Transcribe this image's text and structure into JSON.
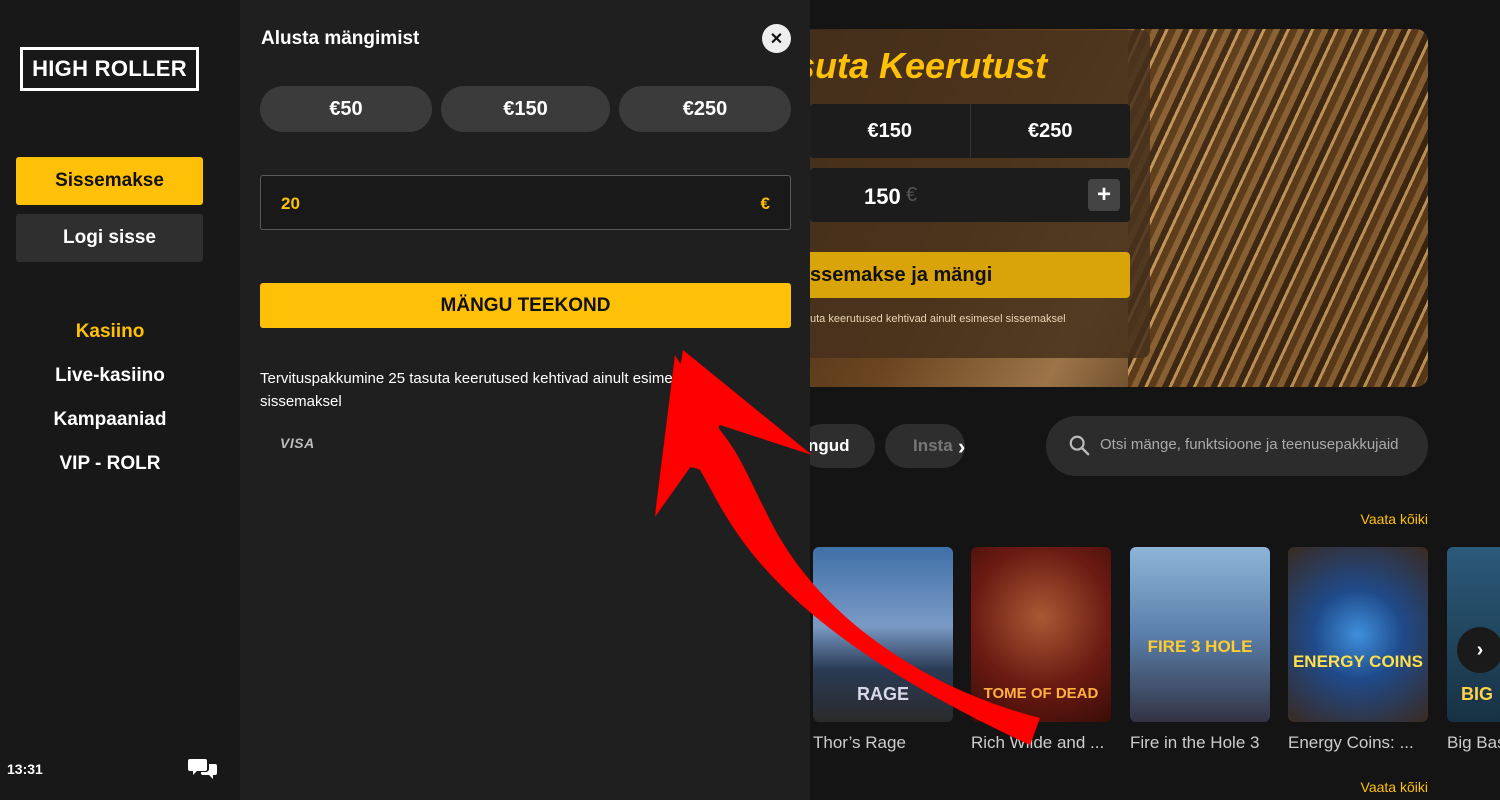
{
  "sidebar": {
    "logo": "HIGH ROLLER",
    "deposit_label": "Sissemakse",
    "login_label": "Logi sisse",
    "nav": [
      {
        "label": "Kasiino",
        "active": true
      },
      {
        "label": "Live-kasiino",
        "active": false
      },
      {
        "label": "Kampaaniad",
        "active": false
      },
      {
        "label": "VIP - ROLR",
        "active": false
      }
    ],
    "time": "13:31",
    "chat_icon": "chat-icon"
  },
  "deposit_panel": {
    "title": "Alusta mängimist",
    "close_icon": "close-icon",
    "presets": [
      "€50",
      "€150",
      "€250"
    ],
    "amount_value": "20",
    "amount_currency": "€",
    "play_button": "MÄNGU TEEKOND",
    "bonus_note": "Tervituspakkumine 25 tasuta keerutused kehtivad ainult esimesel sissemaksel",
    "payment_logo": "VISA"
  },
  "promo": {
    "title": "suta Keerutust",
    "amounts": [
      "€150",
      "€250"
    ],
    "stepper_value": "150",
    "stepper_unit": "€",
    "stepper_plus": "+",
    "cta": "ssemakse ja mängi",
    "note": "uta keerutused kehtivad ainult esimesel sissemaksel"
  },
  "filters": {
    "chips": [
      "ngud",
      "Insta"
    ],
    "next_icon": "chevron-right-icon"
  },
  "search": {
    "placeholder": "Otsi mänge, funktsioone ja teenusepakkujaid"
  },
  "games": {
    "see_all": "Vaata kõiki",
    "see_all_2": "Vaata kõiki",
    "tiles": [
      {
        "name": "Thor’s Rage",
        "art": "RAGE"
      },
      {
        "name": "Rich Wilde and ...",
        "art": "TOME OF DEAD"
      },
      {
        "name": "Fire in the Hole 3",
        "art": "FIRE 3 HOLE"
      },
      {
        "name": "Energy Coins: ...",
        "art": "ENERGY COINS"
      },
      {
        "name": "Big Bas",
        "art": "BIG"
      }
    ]
  },
  "colors": {
    "accent": "#ffc107",
    "panel_bg": "#1f1f1f",
    "annotation_arrow": "#ff0000"
  }
}
